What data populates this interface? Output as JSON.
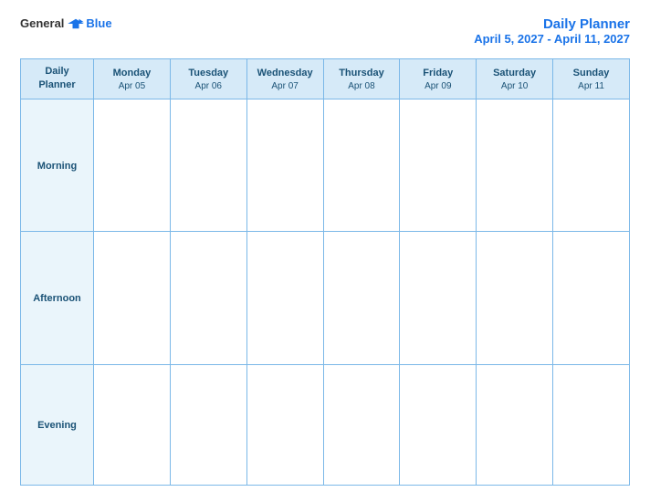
{
  "logo": {
    "general": "General",
    "blue": "Blue"
  },
  "title": {
    "main": "Daily Planner",
    "date_range": "April 5, 2027 - April 11, 2027"
  },
  "header_row": {
    "col0": {
      "line1": "Daily",
      "line2": "Planner",
      "date": ""
    },
    "col1": {
      "line1": "Monday",
      "date": "Apr 05"
    },
    "col2": {
      "line1": "Tuesday",
      "date": "Apr 06"
    },
    "col3": {
      "line1": "Wednesday",
      "date": "Apr 07"
    },
    "col4": {
      "line1": "Thursday",
      "date": "Apr 08"
    },
    "col5": {
      "line1": "Friday",
      "date": "Apr 09"
    },
    "col6": {
      "line1": "Saturday",
      "date": "Apr 10"
    },
    "col7": {
      "line1": "Sunday",
      "date": "Apr 11"
    }
  },
  "rows": {
    "morning": "Morning",
    "afternoon": "Afternoon",
    "evening": "Evening"
  }
}
